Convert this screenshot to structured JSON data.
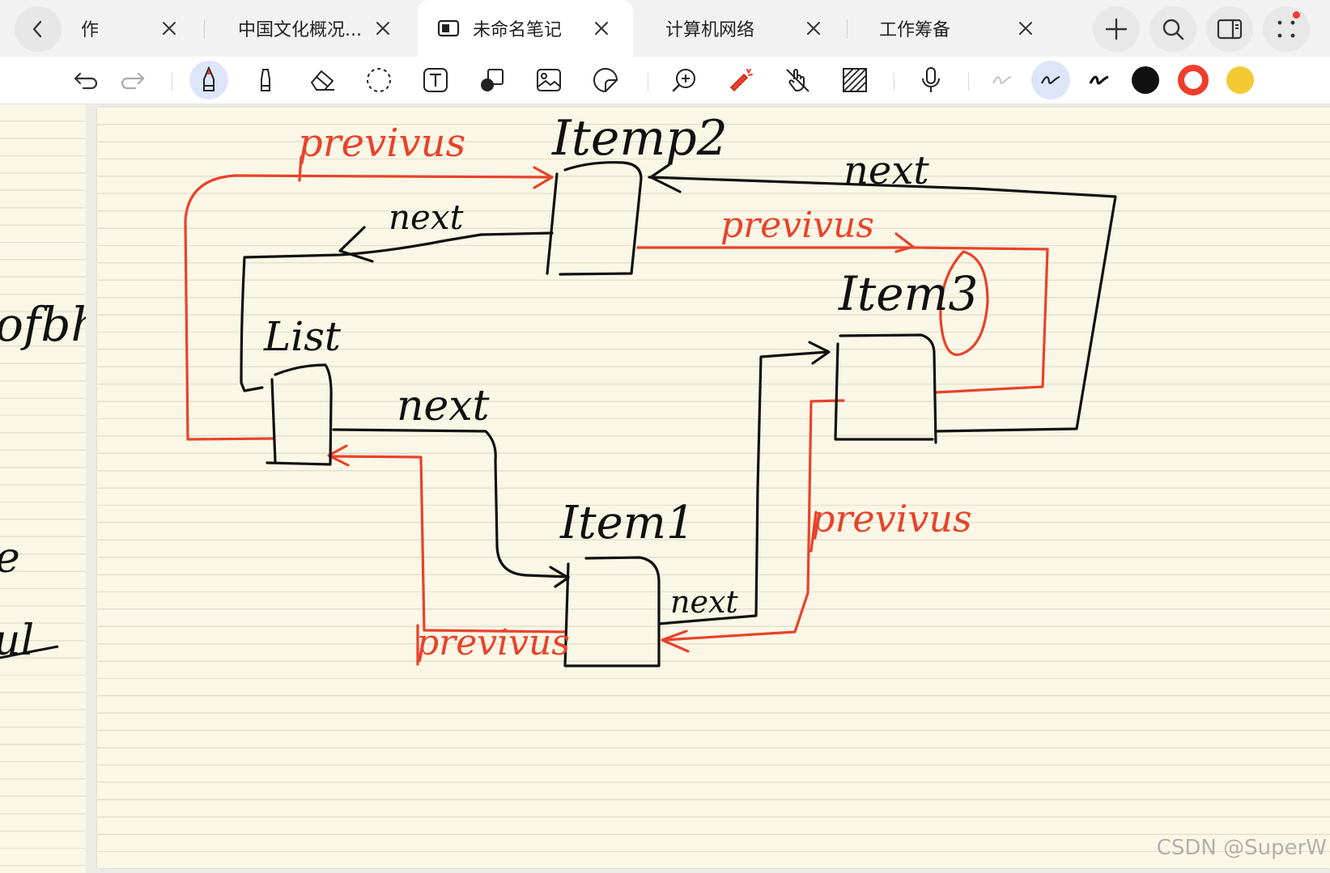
{
  "tabs": [
    {
      "label": "作",
      "active": false
    },
    {
      "label": "中国文化概况...",
      "active": false
    },
    {
      "label": "未命名笔记",
      "active": true
    },
    {
      "label": "计算机网络",
      "active": false
    },
    {
      "label": "工作筹备",
      "active": false
    }
  ],
  "toolbar": {
    "icons": [
      "undo-icon",
      "redo-icon",
      "pen-icon",
      "highlighter-icon",
      "eraser-icon",
      "lasso-icon",
      "text-box-icon",
      "shape-icon",
      "image-icon",
      "sticker-icon",
      "zoom-icon",
      "laser-pointer-icon",
      "hand-touch-icon",
      "pattern-icon",
      "microphone-icon",
      "stroke-thin-icon",
      "stroke-medium-icon",
      "stroke-thick-icon"
    ],
    "colors": [
      "#111111",
      "#ef3d2c",
      "#f3c934"
    ]
  },
  "diagram": {
    "nodes": {
      "list": "List",
      "item1": "Item1",
      "item2": "Itemp2",
      "item3": "Item3"
    },
    "labels": {
      "next_top_right": "next",
      "next_item2_to_list": "next",
      "next_list_to_item1": "next",
      "next_item1_to_item3": "next",
      "previous_top": "previvus",
      "previous_item2_item3": "previvus",
      "previous_item1_list": "previvus",
      "previous_item3_item1": "previvus"
    },
    "ink_colors": {
      "black": "#111111",
      "red": "#e8432b"
    }
  },
  "left_page_fragments": [
    "ofbhe",
    "e",
    "ul"
  ],
  "watermark": "CSDN @SuperW"
}
